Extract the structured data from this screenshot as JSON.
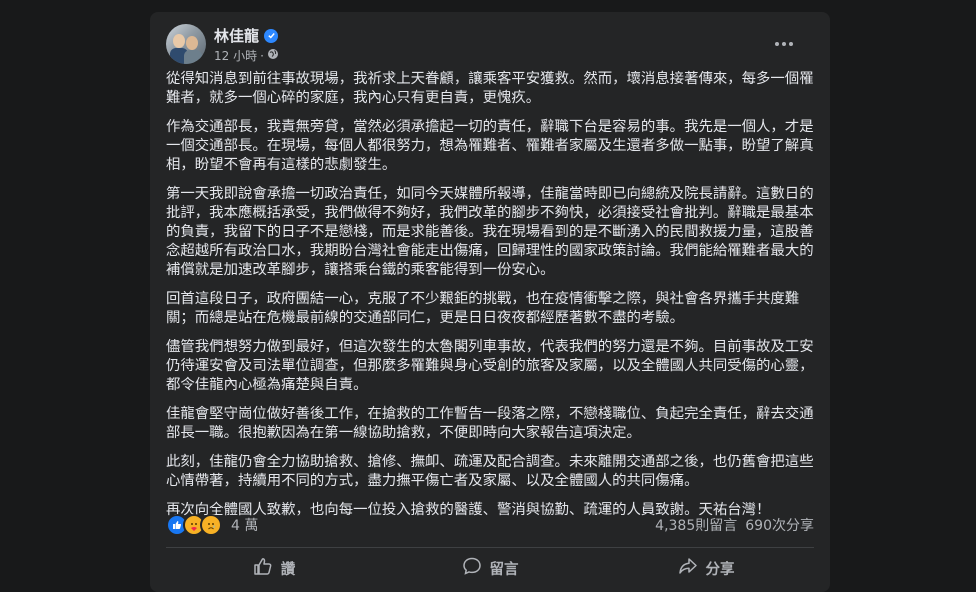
{
  "post": {
    "author": "林佳龍",
    "time": "12 小時",
    "separator": "·",
    "paragraphs": [
      "從得知消息到前往事故現場，我祈求上天眷顧，讓乘客平安獲救。然而，壞消息接著傳來，每多一個罹難者，就多一個心碎的家庭，我內心只有更自責，更愧疚。",
      "作為交通部長，我責無旁貸，當然必須承擔起一切的責任，辭職下台是容易的事。我先是一個人，才是一個交通部長。在現場，每個人都很努力，想為罹難者、罹難者家屬及生還者多做一點事，盼望了解真相，盼望不會再有這樣的悲劇發生。",
      "第一天我即說會承擔一切政治責任，如同今天媒體所報導，佳龍當時即已向總統及院長請辭。這數日的批評，我本應概括承受，我們做得不夠好，我們改革的腳步不夠快，必須接受社會批判。辭職是最基本的負責，我留下的日子不是戀棧，而是求能善後。我在現場看到的是不斷湧入的民間救援力量，這股善念超越所有政治口水，我期盼台灣社會能走出傷痛，回歸理性的國家政策討論。我們能給罹難者最大的補償就是加速改革腳步，讓搭乘台鐵的乘客能得到一份安心。",
      "回首這段日子，政府團結一心，克服了不少艱鉅的挑戰，也在疫情衝擊之際，與社會各界攜手共度難關；而總是站在危機最前線的交通部同仁，更是日日夜夜都經歷著數不盡的考驗。",
      "儘管我們想努力做到最好，但這次發生的太魯閣列車事故，代表我們的努力還是不夠。目前事故及工安仍待運安會及司法單位調查，但那麼多罹難與身心受創的旅客及家屬，以及全體國人共同受傷的心靈，都令佳龍內心極為痛楚與自責。",
      "佳龍會堅守崗位做好善後工作，在搶救的工作暫告一段落之際，不戀棧職位、負起完全責任，辭去交通部長一職。很抱歉因為在第一線協助搶救，不便即時向大家報告這項決定。",
      "此刻，佳龍仍會全力協助搶救、搶修、撫卹、疏運及配合調查。未來離開交通部之後，也仍舊會把這些心情帶著，持續用不同的方式，盡力撫平傷亡者及家屬、以及全體國人的共同傷痛。",
      "再次向全體國人致歉，也向每一位投入搶救的醫護、警消與協勤、疏運的人員致謝。天祐台灣！"
    ],
    "reactions_count": "4 萬",
    "comments_count": "4,385則留言",
    "shares_count": "690次分享"
  },
  "actions": {
    "like": "讚",
    "comment": "留言",
    "share": "分享"
  },
  "icons": {
    "verified": "verified-badge-icon",
    "privacy": "globe-icon",
    "more": "more-options-icon",
    "like": "thumbs-up-icon",
    "comment": "comment-bubble-icon",
    "share": "share-arrow-icon"
  },
  "colors": {
    "background": "#18191a",
    "card": "#242526",
    "text": "#e4e6eb",
    "muted": "#b0b3b8",
    "accent": "#2d88ff"
  }
}
